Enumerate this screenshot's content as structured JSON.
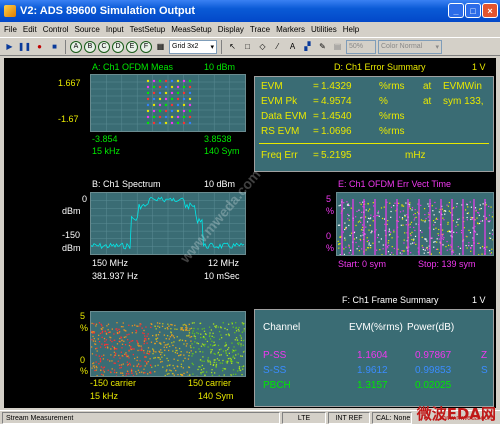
{
  "window": {
    "title": "V2: ADS 89600 Simulation Output"
  },
  "menu": [
    "File",
    "Edit",
    "Control",
    "Source",
    "Input",
    "TestSetup",
    "MeasSetup",
    "Display",
    "Trace",
    "Markers",
    "Utilities",
    "Help"
  ],
  "toolbar": {
    "grid_select": "Grid 3x2",
    "percent": "50%",
    "color_select": "Color Normal",
    "circles": [
      "A",
      "B",
      "C",
      "D",
      "E",
      "F"
    ]
  },
  "traceA": {
    "title": "A: Ch1 OFDM Meas",
    "ref": "10 dBm",
    "y_top": "1.667",
    "y_bot": "-1.67",
    "x_left": "-3.854",
    "x_right": "3.8538",
    "res": "15 kHz",
    "span": "140 Sym"
  },
  "traceB": {
    "title": "B: Ch1 Spectrum",
    "ref": "10 dBm",
    "y_top": "0",
    "y_unit_top": "dBm",
    "y_bot": "-150",
    "y_unit_bot": "dBm",
    "x_left": "150 MHz",
    "x_right": "12 MHz",
    "rbw": "381.937 Hz",
    "time": "10 mSec"
  },
  "traceC": {
    "y_top": "5",
    "unit_top": "%",
    "y_bot": "0",
    "unit_bot": "%",
    "x_left": "-150  carrier",
    "x_right": "150  carrier",
    "res": "15 kHz",
    "span": "140  Sym"
  },
  "traceD": {
    "title": "D: Ch1 Error Summary",
    "scale": "1 V",
    "rows": [
      {
        "name": "EVM",
        "eq": "=",
        "val": "1.4329",
        "unit": "%rms",
        "at": "at",
        "extra": "EVMWin"
      },
      {
        "name": "EVM Pk",
        "eq": "=",
        "val": "4.9574",
        "unit": "%",
        "at": "at",
        "extra": "sym 133,"
      },
      {
        "name": "Data EVM",
        "eq": "=",
        "val": "1.4540",
        "unit": "%rms",
        "at": "",
        "extra": ""
      },
      {
        "name": "RS EVM",
        "eq": "=",
        "val": "1.0696",
        "unit": "%rms",
        "at": "",
        "extra": ""
      }
    ],
    "freq_err": {
      "name": "Freq Err",
      "eq": "=",
      "val": "5.2195",
      "unit": "mHz"
    }
  },
  "traceE": {
    "title": "E: Ch1 OFDM Err Vect Time",
    "y_top": "5",
    "unit_top": "%",
    "y_bot": "0",
    "unit_bot": "%",
    "start": "Start: 0  sym",
    "stop": "Stop: 139  sym"
  },
  "traceF": {
    "title": "F: Ch1 Frame Summary",
    "scale": "1 V",
    "headers": [
      "Channel",
      "EVM(%rms)",
      "Power(dB)"
    ],
    "rows": [
      {
        "channel": "P-SS",
        "evm": "1.1604",
        "power": "0.97867",
        "trail": "Z"
      },
      {
        "channel": "S-SS",
        "evm": "1.9612",
        "power": "0.99853",
        "trail": "S"
      },
      {
        "channel": "PBCH",
        "evm": "1.3157",
        "power": "0.02025",
        "trail": ""
      }
    ]
  },
  "status": {
    "left": "Stream Measurement",
    "lte": "LTE",
    "ref": "INT REF",
    "cal": "CAL: None"
  },
  "watermark": {
    "text": "微波EDA网",
    "url": "www.mweda.com",
    "diag": "www.mweda.com"
  },
  "colors": {
    "yellow": "#e8e800",
    "green": "#00e800",
    "magenta": "#f038f0",
    "grid": "#3a6c74",
    "spectrum": "#00e8e8"
  }
}
